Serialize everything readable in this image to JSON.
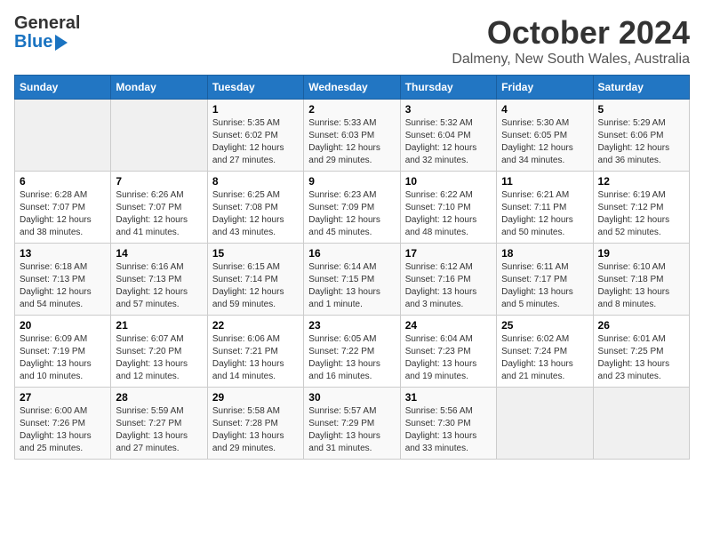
{
  "logo": {
    "general": "General",
    "blue": "Blue"
  },
  "title": "October 2024",
  "subtitle": "Dalmeny, New South Wales, Australia",
  "headers": [
    "Sunday",
    "Monday",
    "Tuesday",
    "Wednesday",
    "Thursday",
    "Friday",
    "Saturday"
  ],
  "weeks": [
    [
      {
        "day": "",
        "info": ""
      },
      {
        "day": "",
        "info": ""
      },
      {
        "day": "1",
        "info": "Sunrise: 5:35 AM\nSunset: 6:02 PM\nDaylight: 12 hours\nand 27 minutes."
      },
      {
        "day": "2",
        "info": "Sunrise: 5:33 AM\nSunset: 6:03 PM\nDaylight: 12 hours\nand 29 minutes."
      },
      {
        "day": "3",
        "info": "Sunrise: 5:32 AM\nSunset: 6:04 PM\nDaylight: 12 hours\nand 32 minutes."
      },
      {
        "day": "4",
        "info": "Sunrise: 5:30 AM\nSunset: 6:05 PM\nDaylight: 12 hours\nand 34 minutes."
      },
      {
        "day": "5",
        "info": "Sunrise: 5:29 AM\nSunset: 6:06 PM\nDaylight: 12 hours\nand 36 minutes."
      }
    ],
    [
      {
        "day": "6",
        "info": "Sunrise: 6:28 AM\nSunset: 7:07 PM\nDaylight: 12 hours\nand 38 minutes."
      },
      {
        "day": "7",
        "info": "Sunrise: 6:26 AM\nSunset: 7:07 PM\nDaylight: 12 hours\nand 41 minutes."
      },
      {
        "day": "8",
        "info": "Sunrise: 6:25 AM\nSunset: 7:08 PM\nDaylight: 12 hours\nand 43 minutes."
      },
      {
        "day": "9",
        "info": "Sunrise: 6:23 AM\nSunset: 7:09 PM\nDaylight: 12 hours\nand 45 minutes."
      },
      {
        "day": "10",
        "info": "Sunrise: 6:22 AM\nSunset: 7:10 PM\nDaylight: 12 hours\nand 48 minutes."
      },
      {
        "day": "11",
        "info": "Sunrise: 6:21 AM\nSunset: 7:11 PM\nDaylight: 12 hours\nand 50 minutes."
      },
      {
        "day": "12",
        "info": "Sunrise: 6:19 AM\nSunset: 7:12 PM\nDaylight: 12 hours\nand 52 minutes."
      }
    ],
    [
      {
        "day": "13",
        "info": "Sunrise: 6:18 AM\nSunset: 7:13 PM\nDaylight: 12 hours\nand 54 minutes."
      },
      {
        "day": "14",
        "info": "Sunrise: 6:16 AM\nSunset: 7:13 PM\nDaylight: 12 hours\nand 57 minutes."
      },
      {
        "day": "15",
        "info": "Sunrise: 6:15 AM\nSunset: 7:14 PM\nDaylight: 12 hours\nand 59 minutes."
      },
      {
        "day": "16",
        "info": "Sunrise: 6:14 AM\nSunset: 7:15 PM\nDaylight: 13 hours\nand 1 minute."
      },
      {
        "day": "17",
        "info": "Sunrise: 6:12 AM\nSunset: 7:16 PM\nDaylight: 13 hours\nand 3 minutes."
      },
      {
        "day": "18",
        "info": "Sunrise: 6:11 AM\nSunset: 7:17 PM\nDaylight: 13 hours\nand 5 minutes."
      },
      {
        "day": "19",
        "info": "Sunrise: 6:10 AM\nSunset: 7:18 PM\nDaylight: 13 hours\nand 8 minutes."
      }
    ],
    [
      {
        "day": "20",
        "info": "Sunrise: 6:09 AM\nSunset: 7:19 PM\nDaylight: 13 hours\nand 10 minutes."
      },
      {
        "day": "21",
        "info": "Sunrise: 6:07 AM\nSunset: 7:20 PM\nDaylight: 13 hours\nand 12 minutes."
      },
      {
        "day": "22",
        "info": "Sunrise: 6:06 AM\nSunset: 7:21 PM\nDaylight: 13 hours\nand 14 minutes."
      },
      {
        "day": "23",
        "info": "Sunrise: 6:05 AM\nSunset: 7:22 PM\nDaylight: 13 hours\nand 16 minutes."
      },
      {
        "day": "24",
        "info": "Sunrise: 6:04 AM\nSunset: 7:23 PM\nDaylight: 13 hours\nand 19 minutes."
      },
      {
        "day": "25",
        "info": "Sunrise: 6:02 AM\nSunset: 7:24 PM\nDaylight: 13 hours\nand 21 minutes."
      },
      {
        "day": "26",
        "info": "Sunrise: 6:01 AM\nSunset: 7:25 PM\nDaylight: 13 hours\nand 23 minutes."
      }
    ],
    [
      {
        "day": "27",
        "info": "Sunrise: 6:00 AM\nSunset: 7:26 PM\nDaylight: 13 hours\nand 25 minutes."
      },
      {
        "day": "28",
        "info": "Sunrise: 5:59 AM\nSunset: 7:27 PM\nDaylight: 13 hours\nand 27 minutes."
      },
      {
        "day": "29",
        "info": "Sunrise: 5:58 AM\nSunset: 7:28 PM\nDaylight: 13 hours\nand 29 minutes."
      },
      {
        "day": "30",
        "info": "Sunrise: 5:57 AM\nSunset: 7:29 PM\nDaylight: 13 hours\nand 31 minutes."
      },
      {
        "day": "31",
        "info": "Sunrise: 5:56 AM\nSunset: 7:30 PM\nDaylight: 13 hours\nand 33 minutes."
      },
      {
        "day": "",
        "info": ""
      },
      {
        "day": "",
        "info": ""
      }
    ]
  ]
}
